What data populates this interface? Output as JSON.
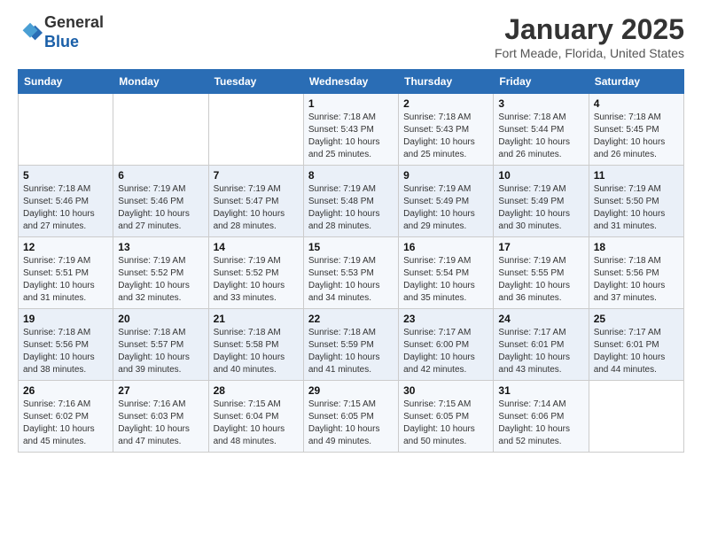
{
  "header": {
    "logo_general": "General",
    "logo_blue": "Blue",
    "title": "January 2025",
    "subtitle": "Fort Meade, Florida, United States"
  },
  "weekdays": [
    "Sunday",
    "Monday",
    "Tuesday",
    "Wednesday",
    "Thursday",
    "Friday",
    "Saturday"
  ],
  "weeks": [
    [
      {
        "day": "",
        "info": ""
      },
      {
        "day": "",
        "info": ""
      },
      {
        "day": "",
        "info": ""
      },
      {
        "day": "1",
        "info": "Sunrise: 7:18 AM\nSunset: 5:43 PM\nDaylight: 10 hours\nand 25 minutes."
      },
      {
        "day": "2",
        "info": "Sunrise: 7:18 AM\nSunset: 5:43 PM\nDaylight: 10 hours\nand 25 minutes."
      },
      {
        "day": "3",
        "info": "Sunrise: 7:18 AM\nSunset: 5:44 PM\nDaylight: 10 hours\nand 26 minutes."
      },
      {
        "day": "4",
        "info": "Sunrise: 7:18 AM\nSunset: 5:45 PM\nDaylight: 10 hours\nand 26 minutes."
      }
    ],
    [
      {
        "day": "5",
        "info": "Sunrise: 7:18 AM\nSunset: 5:46 PM\nDaylight: 10 hours\nand 27 minutes."
      },
      {
        "day": "6",
        "info": "Sunrise: 7:19 AM\nSunset: 5:46 PM\nDaylight: 10 hours\nand 27 minutes."
      },
      {
        "day": "7",
        "info": "Sunrise: 7:19 AM\nSunset: 5:47 PM\nDaylight: 10 hours\nand 28 minutes."
      },
      {
        "day": "8",
        "info": "Sunrise: 7:19 AM\nSunset: 5:48 PM\nDaylight: 10 hours\nand 28 minutes."
      },
      {
        "day": "9",
        "info": "Sunrise: 7:19 AM\nSunset: 5:49 PM\nDaylight: 10 hours\nand 29 minutes."
      },
      {
        "day": "10",
        "info": "Sunrise: 7:19 AM\nSunset: 5:49 PM\nDaylight: 10 hours\nand 30 minutes."
      },
      {
        "day": "11",
        "info": "Sunrise: 7:19 AM\nSunset: 5:50 PM\nDaylight: 10 hours\nand 31 minutes."
      }
    ],
    [
      {
        "day": "12",
        "info": "Sunrise: 7:19 AM\nSunset: 5:51 PM\nDaylight: 10 hours\nand 31 minutes."
      },
      {
        "day": "13",
        "info": "Sunrise: 7:19 AM\nSunset: 5:52 PM\nDaylight: 10 hours\nand 32 minutes."
      },
      {
        "day": "14",
        "info": "Sunrise: 7:19 AM\nSunset: 5:52 PM\nDaylight: 10 hours\nand 33 minutes."
      },
      {
        "day": "15",
        "info": "Sunrise: 7:19 AM\nSunset: 5:53 PM\nDaylight: 10 hours\nand 34 minutes."
      },
      {
        "day": "16",
        "info": "Sunrise: 7:19 AM\nSunset: 5:54 PM\nDaylight: 10 hours\nand 35 minutes."
      },
      {
        "day": "17",
        "info": "Sunrise: 7:19 AM\nSunset: 5:55 PM\nDaylight: 10 hours\nand 36 minutes."
      },
      {
        "day": "18",
        "info": "Sunrise: 7:18 AM\nSunset: 5:56 PM\nDaylight: 10 hours\nand 37 minutes."
      }
    ],
    [
      {
        "day": "19",
        "info": "Sunrise: 7:18 AM\nSunset: 5:56 PM\nDaylight: 10 hours\nand 38 minutes."
      },
      {
        "day": "20",
        "info": "Sunrise: 7:18 AM\nSunset: 5:57 PM\nDaylight: 10 hours\nand 39 minutes."
      },
      {
        "day": "21",
        "info": "Sunrise: 7:18 AM\nSunset: 5:58 PM\nDaylight: 10 hours\nand 40 minutes."
      },
      {
        "day": "22",
        "info": "Sunrise: 7:18 AM\nSunset: 5:59 PM\nDaylight: 10 hours\nand 41 minutes."
      },
      {
        "day": "23",
        "info": "Sunrise: 7:17 AM\nSunset: 6:00 PM\nDaylight: 10 hours\nand 42 minutes."
      },
      {
        "day": "24",
        "info": "Sunrise: 7:17 AM\nSunset: 6:01 PM\nDaylight: 10 hours\nand 43 minutes."
      },
      {
        "day": "25",
        "info": "Sunrise: 7:17 AM\nSunset: 6:01 PM\nDaylight: 10 hours\nand 44 minutes."
      }
    ],
    [
      {
        "day": "26",
        "info": "Sunrise: 7:16 AM\nSunset: 6:02 PM\nDaylight: 10 hours\nand 45 minutes."
      },
      {
        "day": "27",
        "info": "Sunrise: 7:16 AM\nSunset: 6:03 PM\nDaylight: 10 hours\nand 47 minutes."
      },
      {
        "day": "28",
        "info": "Sunrise: 7:15 AM\nSunset: 6:04 PM\nDaylight: 10 hours\nand 48 minutes."
      },
      {
        "day": "29",
        "info": "Sunrise: 7:15 AM\nSunset: 6:05 PM\nDaylight: 10 hours\nand 49 minutes."
      },
      {
        "day": "30",
        "info": "Sunrise: 7:15 AM\nSunset: 6:05 PM\nDaylight: 10 hours\nand 50 minutes."
      },
      {
        "day": "31",
        "info": "Sunrise: 7:14 AM\nSunset: 6:06 PM\nDaylight: 10 hours\nand 52 minutes."
      },
      {
        "day": "",
        "info": ""
      }
    ]
  ]
}
